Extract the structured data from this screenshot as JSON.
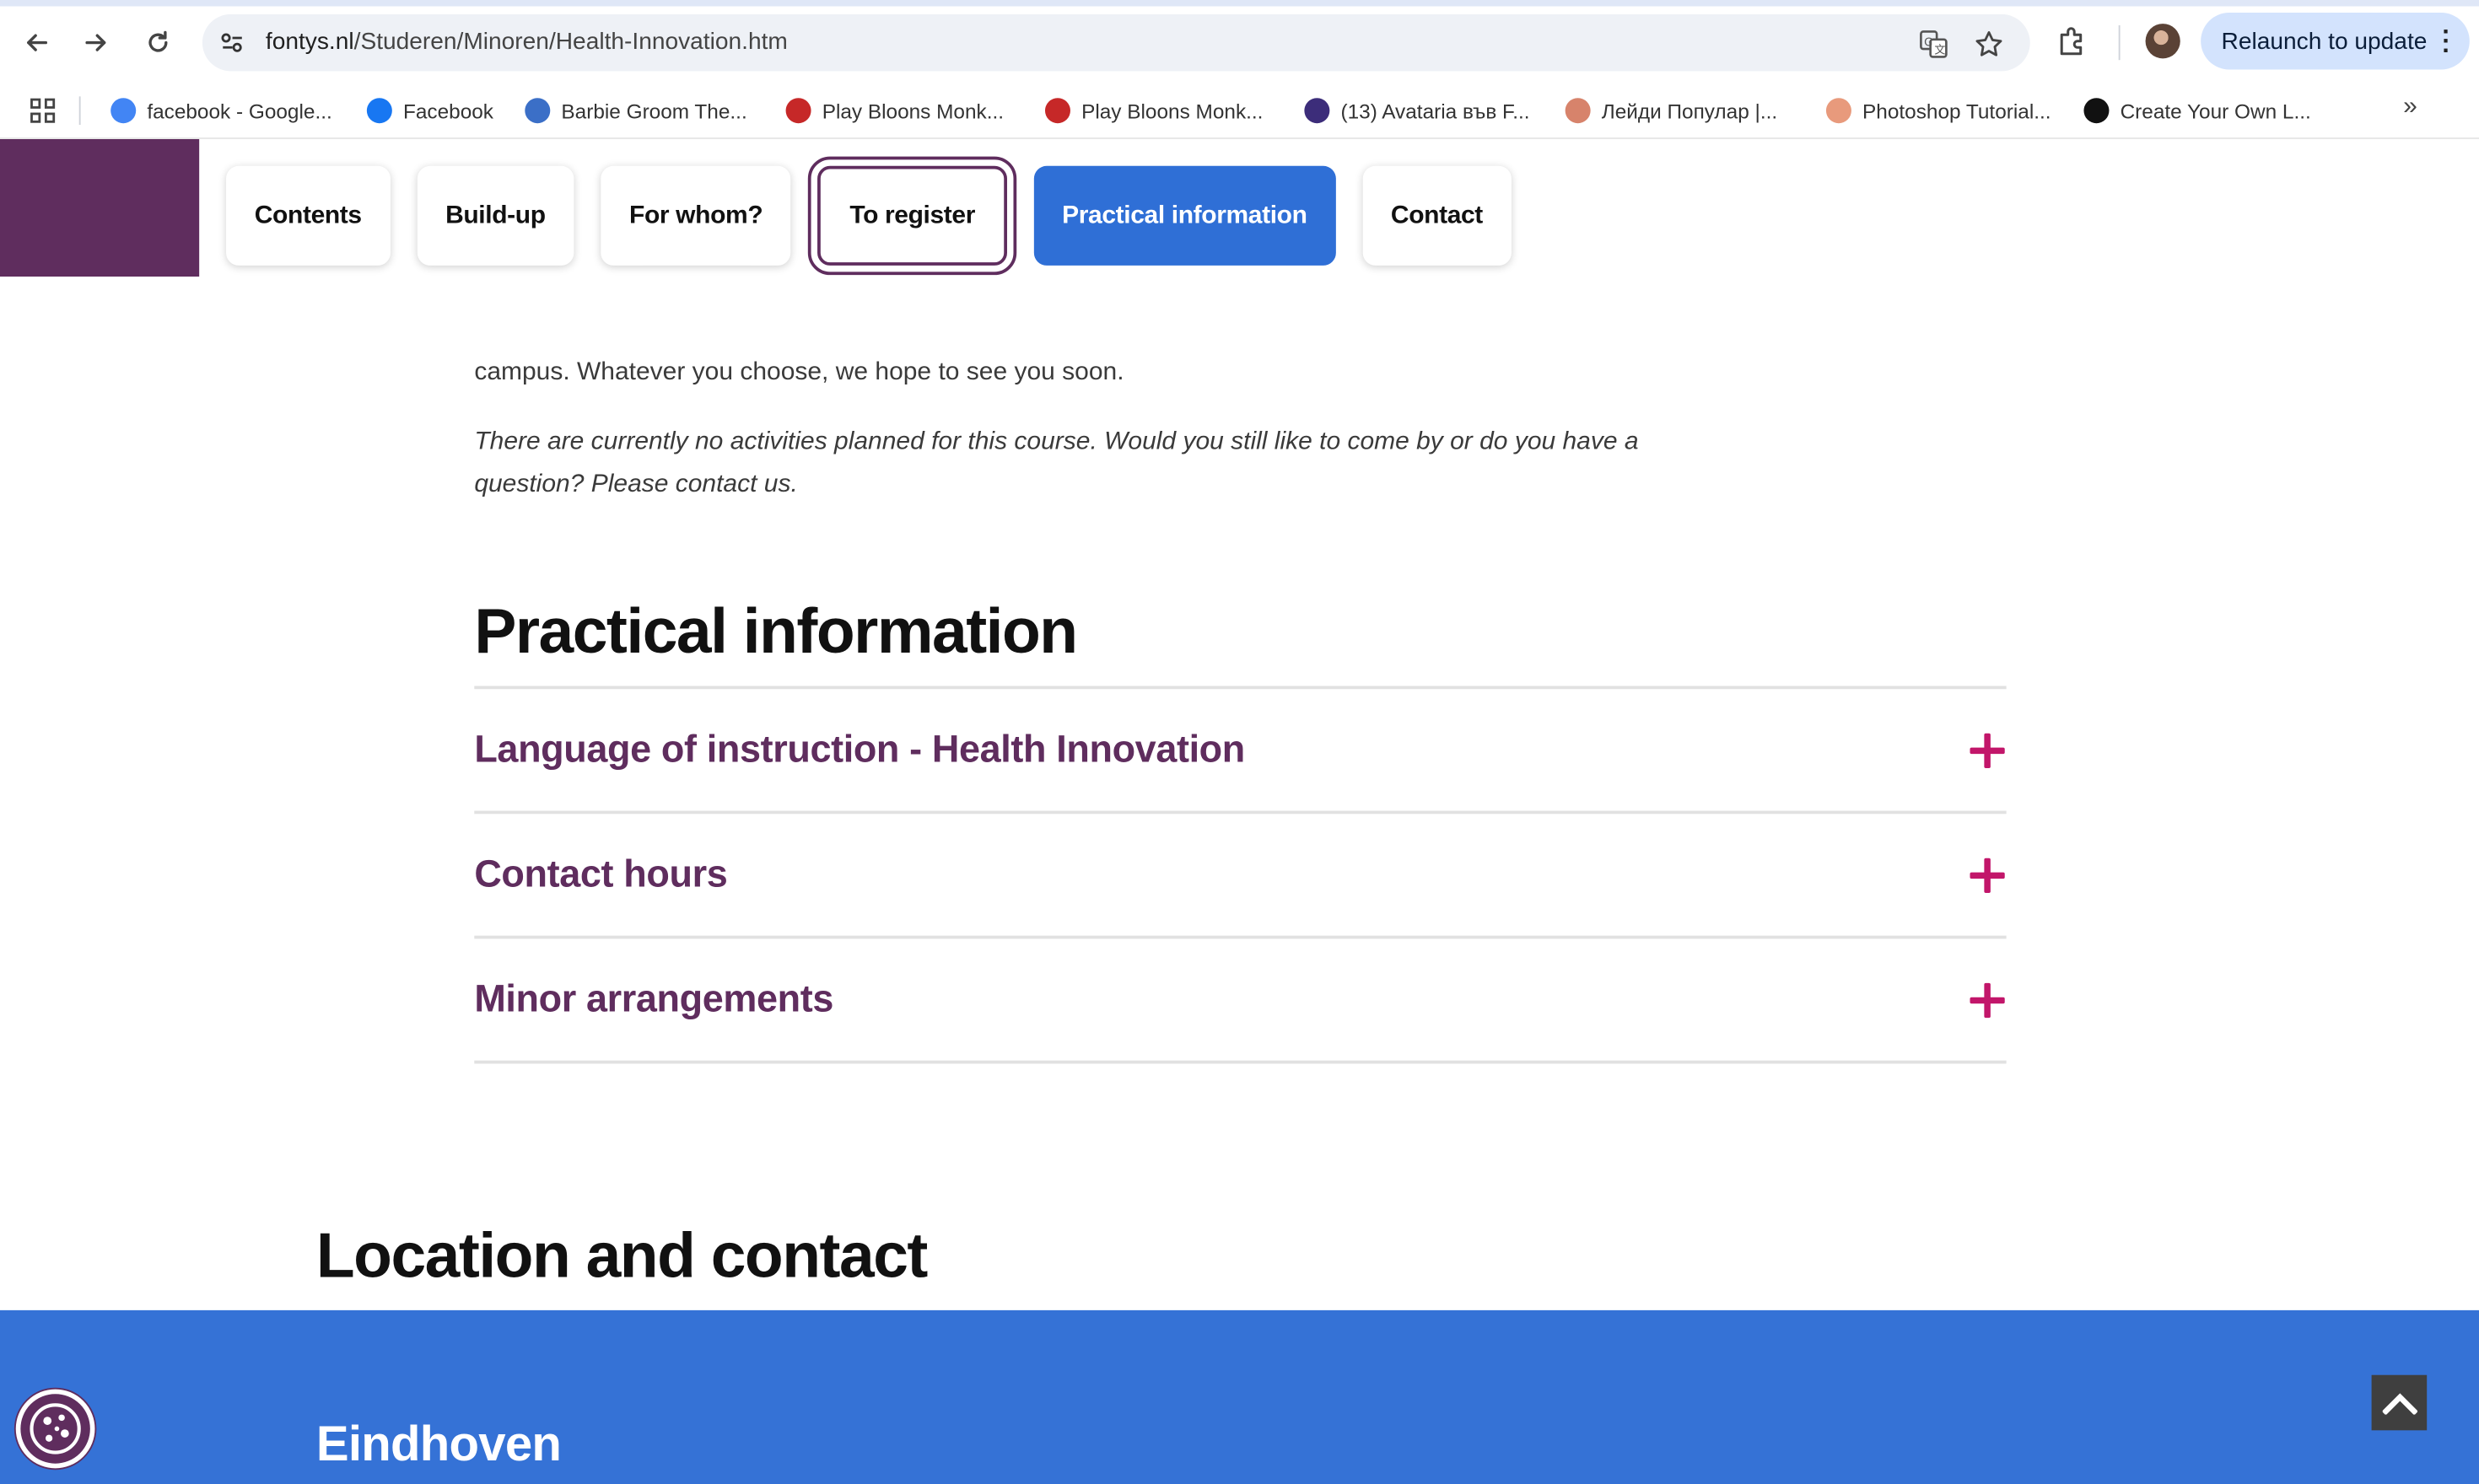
{
  "browser": {
    "url_domain": "fontys.nl",
    "url_path": "/Studeren/Minoren/Health-Innovation.htm",
    "relaunch_label": "Relaunch to update",
    "bookmarks": [
      {
        "label": "facebook - Google...",
        "icon": "google-icon",
        "color": "#4285f4"
      },
      {
        "label": "Facebook",
        "icon": "facebook-icon",
        "color": "#1877f2"
      },
      {
        "label": "Barbie Groom The...",
        "icon": "target-icon",
        "color": "#3b6fc7"
      },
      {
        "label": "Play Bloons Monk...",
        "icon": "bloons-icon",
        "color": "#c62828"
      },
      {
        "label": "Play Bloons Monk...",
        "icon": "bloons-icon",
        "color": "#c62828"
      },
      {
        "label": "(13) Avataria във F...",
        "icon": "avataria-icon",
        "color": "#3c2d7a"
      },
      {
        "label": "Лейди Популар |...",
        "icon": "lady-icon",
        "color": "#d7836b"
      },
      {
        "label": "Photoshop Tutorial...",
        "icon": "dash-icon",
        "color": "#e89a7c"
      },
      {
        "label": "Create Your Own L...",
        "icon": "create-icon",
        "color": "#111111"
      }
    ]
  },
  "nav": {
    "items": [
      "Contents",
      "Build-up",
      "For whom?",
      "To register",
      "Practical information",
      "Contact"
    ],
    "active_index": 4,
    "focused_index": 3
  },
  "intro": {
    "line1": "campus. Whatever you choose, we hope to see you soon.",
    "note": "There are currently no activities planned for this course. Would you still like to come by or do you have a question? Please contact us."
  },
  "practical": {
    "title": "Practical information",
    "items": [
      "Language of instruction - Health Innovation",
      "Contact hours",
      "Minor arrangements"
    ]
  },
  "location": {
    "title": "Location and contact",
    "city": "Eindhoven"
  },
  "colors": {
    "brand_purple": "#5f2d5e",
    "accent_blue": "#3572d6",
    "plus_magenta": "#c2166a"
  }
}
